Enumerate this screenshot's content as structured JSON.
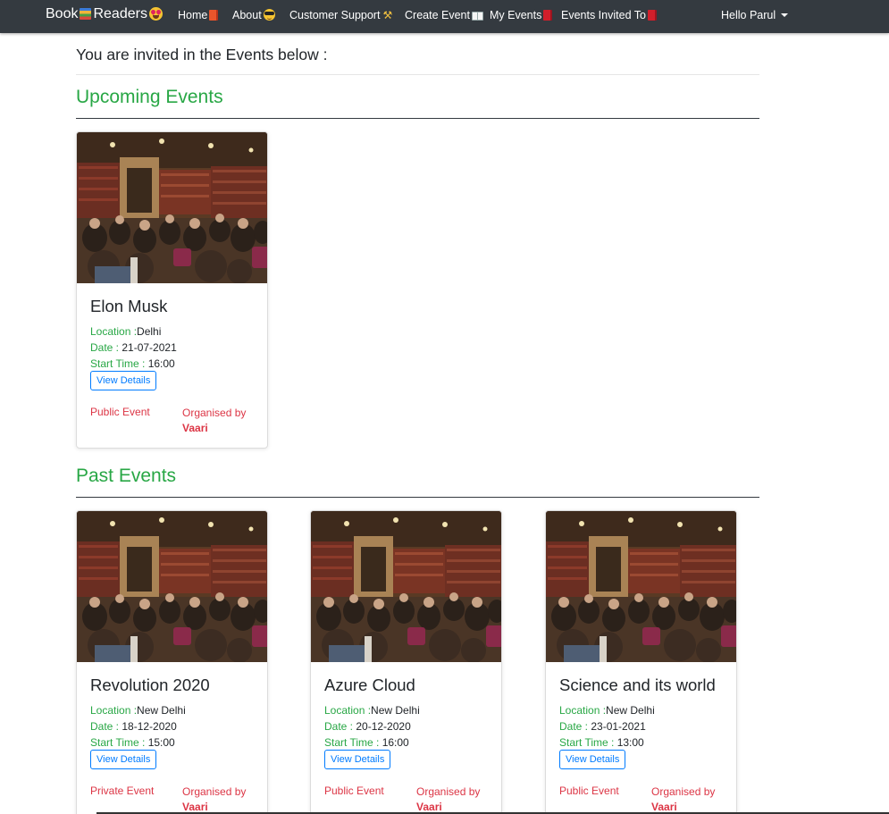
{
  "navbar": {
    "brand_a": "Book",
    "brand_b": "Readers",
    "items": [
      {
        "label": "Home",
        "icon": "orange-book-icon"
      },
      {
        "label": "About",
        "icon": "sunglasses-face-icon"
      },
      {
        "label": "Customer Support",
        "icon": "tools-icon"
      },
      {
        "label": "Create Event",
        "icon": "open-book-icon"
      },
      {
        "label": "My Events",
        "icon": "red-book-icon"
      },
      {
        "label": "Events Invited To",
        "icon": "red-book-icon"
      }
    ],
    "user": "Hello Parul"
  },
  "page": {
    "intro": "You are invited in the Events below :",
    "upcoming_title": "Upcoming Events",
    "past_title": "Past Events"
  },
  "labels": {
    "location": "Location :",
    "date": "Date : ",
    "start_time": "Start Time : ",
    "view_details": "View Details",
    "organised_by": "Organised by"
  },
  "upcoming": [
    {
      "title": "Elon Musk",
      "location": "Delhi",
      "date": "21-07-2021",
      "time": "16:00",
      "type": "Public Event",
      "organiser": "Vaari"
    }
  ],
  "past": [
    {
      "title": "Revolution 2020",
      "location": "New Delhi",
      "date": "18-12-2020",
      "time": "15:00",
      "type": "Private Event",
      "organiser": "Vaari"
    },
    {
      "title": "Azure Cloud",
      "location": "New Delhi",
      "date": "20-12-2020",
      "time": "16:00",
      "type": "Public Event",
      "organiser": "Vaari"
    },
    {
      "title": "Science and its world",
      "location": "New Delhi",
      "date": "23-01-2021",
      "time": "13:00",
      "type": "Public Event",
      "organiser": "Vaari"
    }
  ],
  "colors": {
    "navbar": "#343a40",
    "accent_green": "#28a745",
    "link_blue": "#007bff",
    "danger_red": "#dc3545"
  }
}
